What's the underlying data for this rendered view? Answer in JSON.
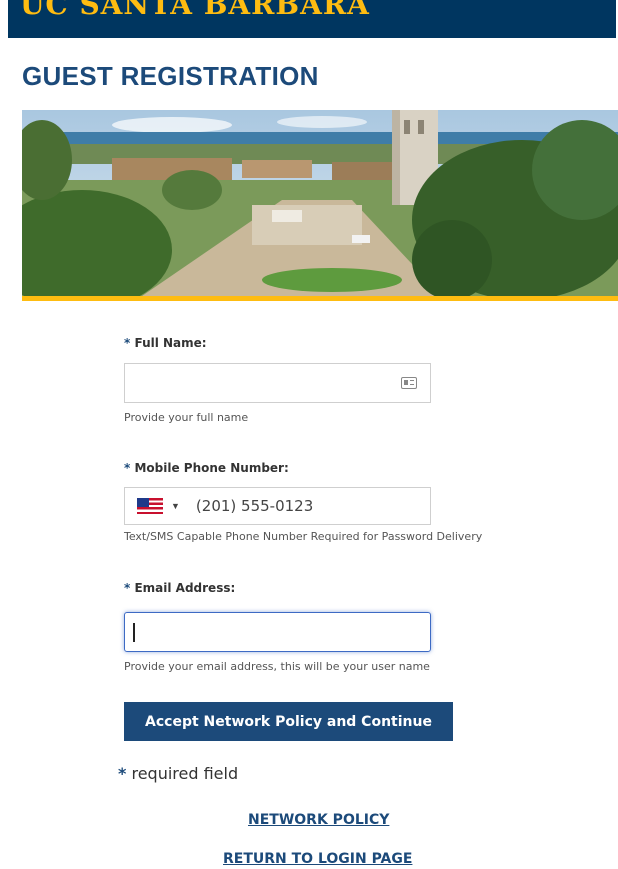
{
  "header": {
    "brand": "UC SANTA BARBARA"
  },
  "page": {
    "title": "GUEST REGISTRATION"
  },
  "form": {
    "required_marker": "*",
    "full_name": {
      "label": "Full Name:",
      "value": "",
      "help": "Provide your full name",
      "icon": "contact-card-icon"
    },
    "mobile_phone": {
      "label": "Mobile Phone Number:",
      "country": "US",
      "value": "(201) 555-0123",
      "help": "Text/SMS Capable Phone Number Required for Password Delivery"
    },
    "email": {
      "label": "Email Address:",
      "value": "",
      "help": "Provide your email address, this will be your user name"
    },
    "submit_label": "Accept Network Policy and Continue",
    "required_note": "required field"
  },
  "links": {
    "network_policy": "NETWORK POLICY",
    "return_login": "RETURN TO LOGIN PAGE"
  },
  "colors": {
    "ucsb_navy": "#003660",
    "ucsb_gold": "#FEBC11",
    "title_blue": "#1c4a7a",
    "focus_blue": "#3d6ac4"
  }
}
